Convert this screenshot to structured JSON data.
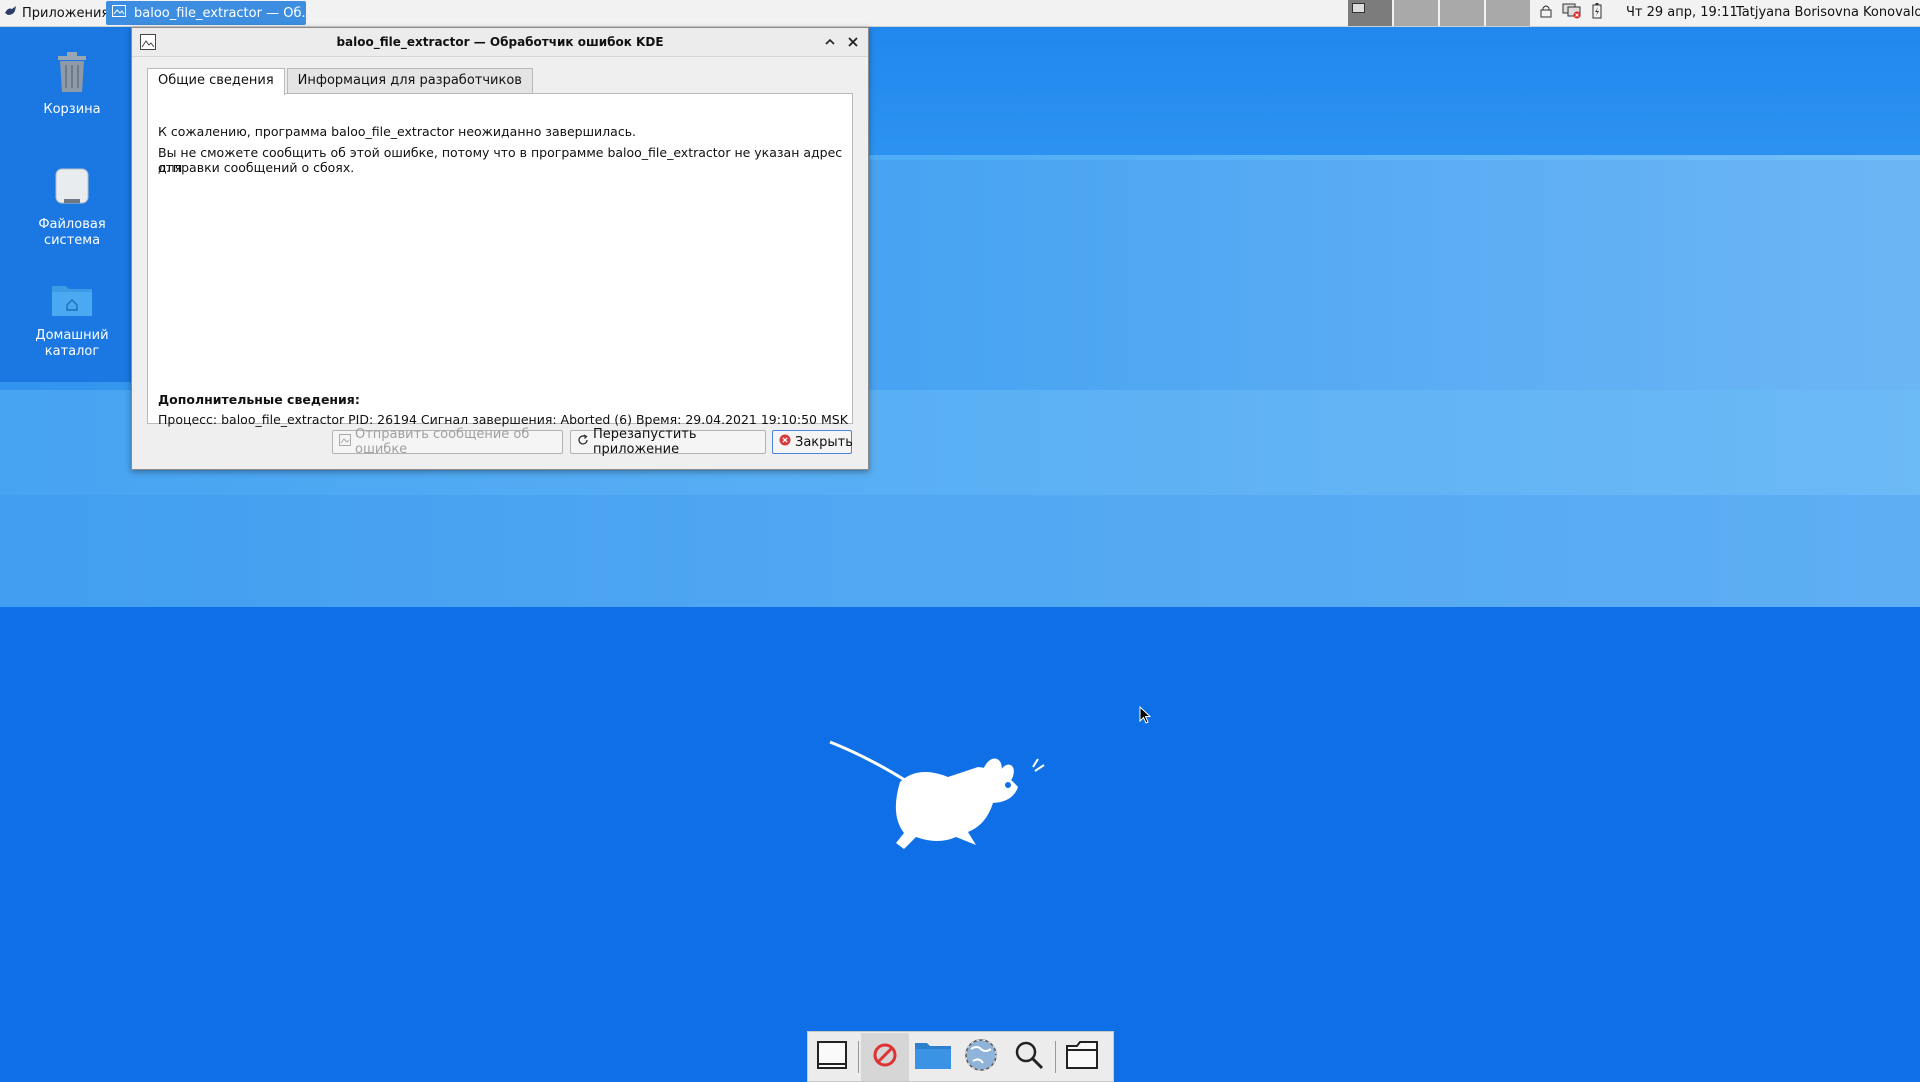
{
  "panel": {
    "menu_label": "Приложения",
    "task_title": "baloo_file_extractor — Об...",
    "clock": "Чт 29 апр, 19:11",
    "user": "Tatjyana Borisovna Konovalova",
    "workspaces": [
      1,
      2,
      3,
      4
    ]
  },
  "desktop": {
    "icons": [
      {
        "label": "Корзина",
        "icon": "trash-icon"
      },
      {
        "label": "Файловая система",
        "icon": "drive-icon"
      },
      {
        "label": "Домашний каталог",
        "icon": "home-folder-icon"
      }
    ]
  },
  "window": {
    "title": "baloo_file_extractor — Обработчик ошибок KDE",
    "tabs": [
      {
        "label": "Общие сведения",
        "active": true
      },
      {
        "label": "Информация для разработчиков",
        "active": false
      }
    ],
    "message1": "К сожалению, программа baloo_file_extractor неожиданно завершилась.",
    "message2_line1": "Вы не сможете сообщить об этой ошибке, потому что в программе baloo_file_extractor не указан адрес для",
    "message2_line2": "отправки сообщений о сбоях.",
    "details_heading": "Дополнительные сведения:",
    "details_text": "Процесс: baloo_file_extractor PID: 26194 Сигнал завершения: Aborted (6) Время: 29.04.2021 19:10:50 MSK",
    "buttons": {
      "report": "Отправить сообщение об ошибке",
      "restart": "Перезапустить приложение",
      "close": "Закрыть"
    }
  },
  "dock": {
    "items": [
      "terminal-icon",
      "blocked-icon",
      "file-manager-icon",
      "web-browser-icon",
      "search-icon",
      "folder-icon"
    ]
  },
  "colors": {
    "desktop": "#0f6fe6",
    "panel": "#f2f2f2",
    "task_active": "#3d8ee0"
  }
}
